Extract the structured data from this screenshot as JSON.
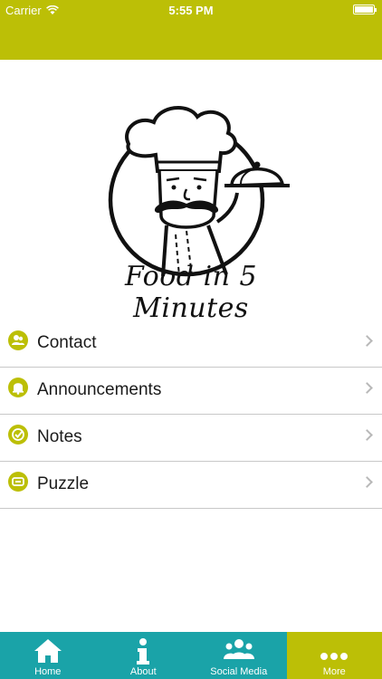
{
  "status_bar": {
    "carrier": "Carrier",
    "time": "5:55 PM"
  },
  "logo": {
    "text": "Food in 5 Minutes"
  },
  "menu": {
    "items": [
      {
        "label": "Contact",
        "icon": "contact-icon"
      },
      {
        "label": "Announcements",
        "icon": "bell-icon"
      },
      {
        "label": "Notes",
        "icon": "check-icon"
      },
      {
        "label": "Puzzle",
        "icon": "puzzle-icon"
      }
    ]
  },
  "tabbar": {
    "tabs": [
      {
        "label": "Home",
        "icon": "home-icon"
      },
      {
        "label": "About",
        "icon": "info-icon"
      },
      {
        "label": "Social Media",
        "icon": "people-icon"
      },
      {
        "label": "More",
        "icon": "more-icon",
        "active": true
      }
    ]
  },
  "colors": {
    "accent": "#bcbf06",
    "tabbar": "#1aa3a8",
    "text": "#1a1a1a"
  }
}
